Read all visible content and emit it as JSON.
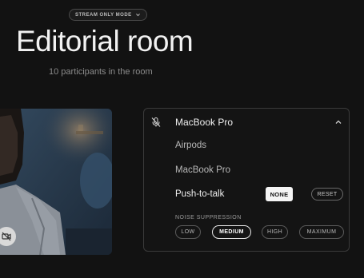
{
  "header": {
    "mode_label": "STREAM ONLY MODE",
    "title": "Editorial room",
    "subtitle": "10 participants in the room"
  },
  "audio_panel": {
    "selected_device": "MacBook Pro",
    "options": [
      "Airpods",
      "MacBook Pro"
    ],
    "push_to_talk": {
      "label": "Push-to-talk",
      "value": "NONE",
      "reset_label": "RESET"
    },
    "noise_suppression": {
      "label": "NOISE SUPPRESSION",
      "levels": [
        "LOW",
        "MEDIUM",
        "HIGH",
        "MAXIMUM"
      ],
      "selected": "MEDIUM"
    }
  },
  "icons": {
    "mode_chevron": "chevron-down-icon",
    "mic": "mic-off-icon",
    "panel_chevron": "chevron-up-icon",
    "camera": "camera-off-icon"
  }
}
